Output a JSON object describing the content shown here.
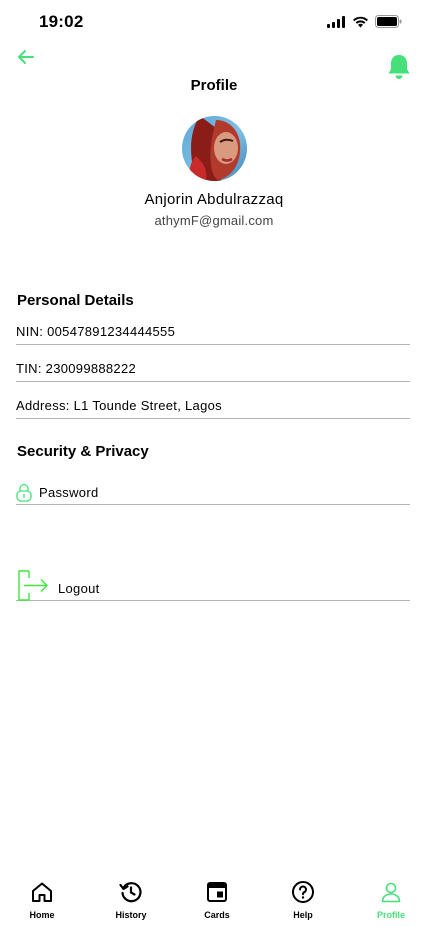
{
  "status_bar": {
    "time": "19:02"
  },
  "header": {
    "title": "Profile"
  },
  "profile": {
    "name": "Anjorin Abdulrazzaq",
    "email": "athymF@gmail.com"
  },
  "personal_details": {
    "heading": "Personal Details",
    "nin": "NIN: 00547891234444555",
    "tin": "TIN: 230099888222",
    "address": "Address: L1 Tounde Street, Lagos"
  },
  "security": {
    "heading": "Security & Privacy",
    "password_label": "Password"
  },
  "logout": {
    "label": "Logout"
  },
  "bottom_nav": {
    "items": [
      {
        "label": "Home",
        "icon": "home-icon"
      },
      {
        "label": "History",
        "icon": "history-icon"
      },
      {
        "label": "Cards",
        "icon": "cards-icon"
      },
      {
        "label": "Help",
        "icon": "help-icon"
      },
      {
        "label": "Profile",
        "icon": "profile-icon",
        "active": true
      }
    ]
  },
  "colors": {
    "accent": "#46e07a",
    "logout_accent": "#3ee63e",
    "divider": "#b4b4b4"
  }
}
